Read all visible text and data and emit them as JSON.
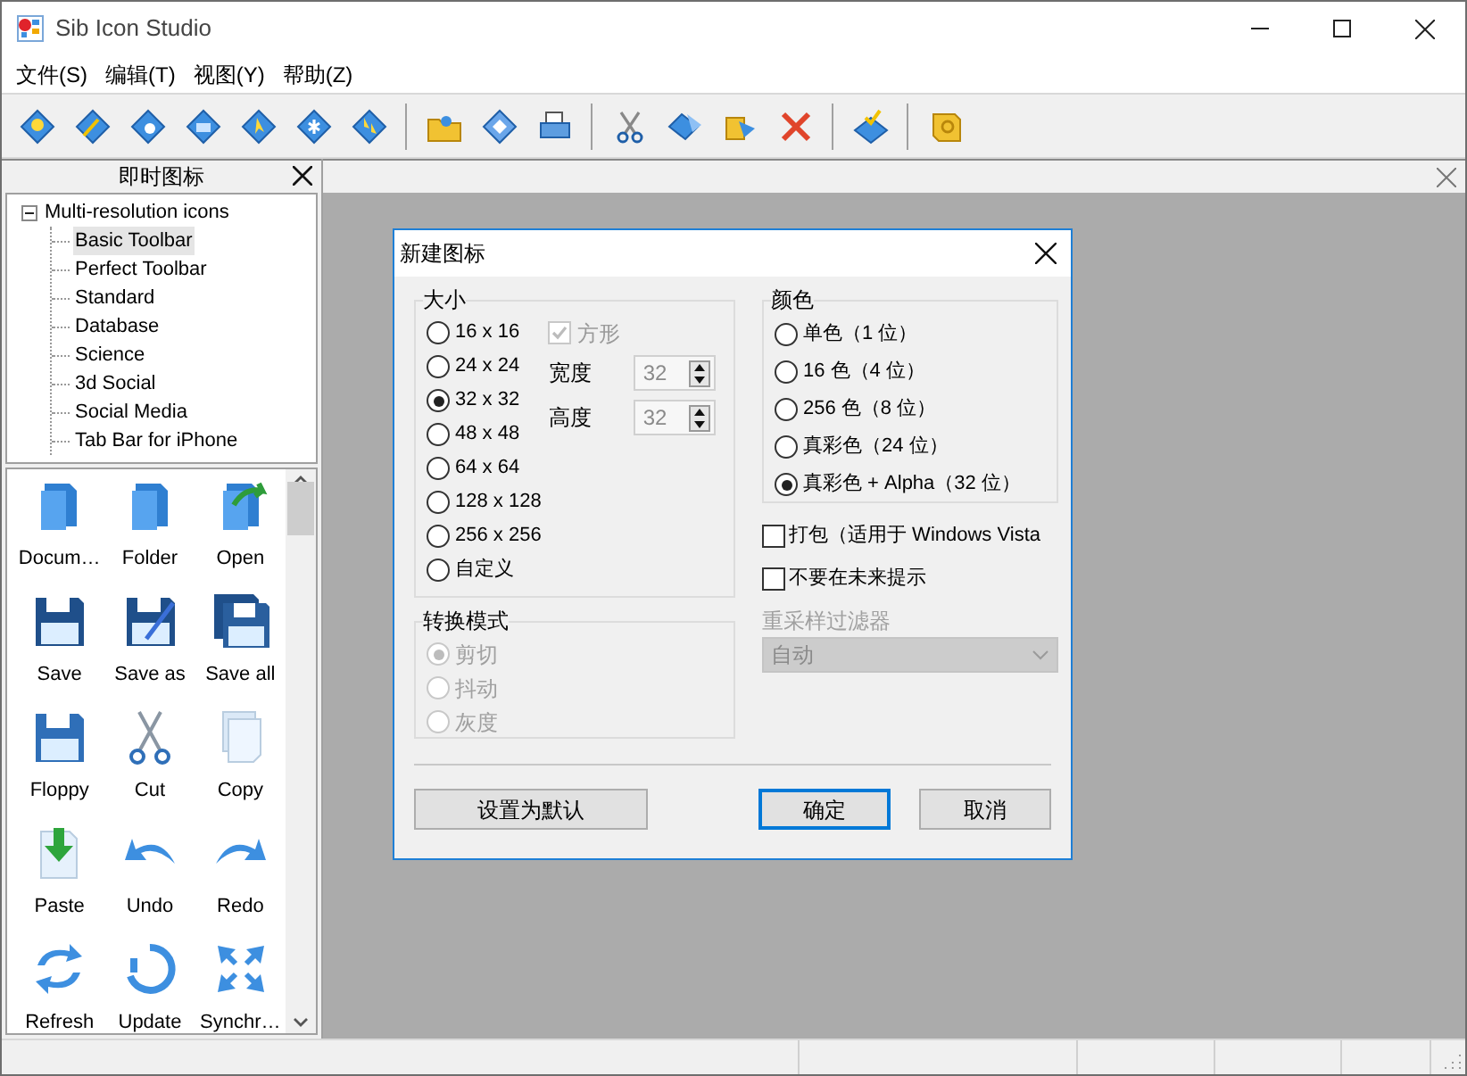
{
  "window": {
    "title": "Sib Icon Studio"
  },
  "menu": [
    "文件(S)",
    "编辑(T)",
    "视图(Y)",
    "帮助(Z)"
  ],
  "palette_panel": {
    "title": "即时图标",
    "tree": [
      {
        "label": "Multi-resolution icons",
        "expanded": true,
        "selected": false,
        "children": [
          {
            "label": "Basic Toolbar",
            "selected": true
          },
          {
            "label": "Perfect Toolbar",
            "selected": false
          },
          {
            "label": "Standard",
            "selected": false
          },
          {
            "label": "Database",
            "selected": false
          },
          {
            "label": "Science",
            "selected": false
          },
          {
            "label": "3d Social",
            "selected": false
          },
          {
            "label": "Social Media",
            "selected": false
          },
          {
            "label": "Tab Bar for iPhone",
            "selected": false
          }
        ]
      }
    ],
    "icons": [
      {
        "label": "Docum…"
      },
      {
        "label": "Folder"
      },
      {
        "label": "Open"
      },
      {
        "label": "Save"
      },
      {
        "label": "Save as"
      },
      {
        "label": "Save all"
      },
      {
        "label": "Floppy"
      },
      {
        "label": "Cut"
      },
      {
        "label": "Copy"
      },
      {
        "label": "Paste"
      },
      {
        "label": "Undo"
      },
      {
        "label": "Redo"
      },
      {
        "label": "Refresh"
      },
      {
        "label": "Update"
      },
      {
        "label": "Synchr…"
      }
    ]
  },
  "dialog": {
    "title": "新建图标",
    "size_group": {
      "label": "大小",
      "options": [
        {
          "label": "16 x 16",
          "selected": false
        },
        {
          "label": "24 x 24",
          "selected": false
        },
        {
          "label": "32 x 32",
          "selected": true
        },
        {
          "label": "48 x 48",
          "selected": false
        },
        {
          "label": "64 x 64",
          "selected": false
        },
        {
          "label": "128 x 128",
          "selected": false
        },
        {
          "label": "256 x 256",
          "selected": false
        },
        {
          "label": "自定义",
          "selected": false
        }
      ],
      "square": {
        "label": "方形",
        "checked": true,
        "disabled": true
      },
      "width": {
        "label": "宽度",
        "value": "32",
        "disabled": true
      },
      "height": {
        "label": "高度",
        "value": "32",
        "disabled": true
      }
    },
    "convert_group": {
      "label": "转换模式",
      "disabled": true,
      "options": [
        {
          "label": "剪切",
          "selected": true
        },
        {
          "label": "抖动",
          "selected": false
        },
        {
          "label": "灰度",
          "selected": false
        }
      ]
    },
    "color_group": {
      "label": "颜色",
      "options": [
        {
          "label": "单色（1 位）",
          "selected": false
        },
        {
          "label": "16 色（4 位）",
          "selected": false
        },
        {
          "label": "256 色（8 位）",
          "selected": false
        },
        {
          "label": "真彩色（24 位）",
          "selected": false
        },
        {
          "label": "真彩色 + Alpha（32 位）",
          "selected": true
        }
      ]
    },
    "checkboxes": [
      {
        "label": "打包（适用于 Windows Vista",
        "checked": false
      },
      {
        "label": "不要在未来提示",
        "checked": false
      }
    ],
    "resample": {
      "label": "重采样过滤器",
      "value": "自动",
      "disabled": true
    },
    "buttons": [
      {
        "label": "设置为默认",
        "default": false
      },
      {
        "label": "确定",
        "default": true
      },
      {
        "label": "取消",
        "default": false
      }
    ]
  }
}
